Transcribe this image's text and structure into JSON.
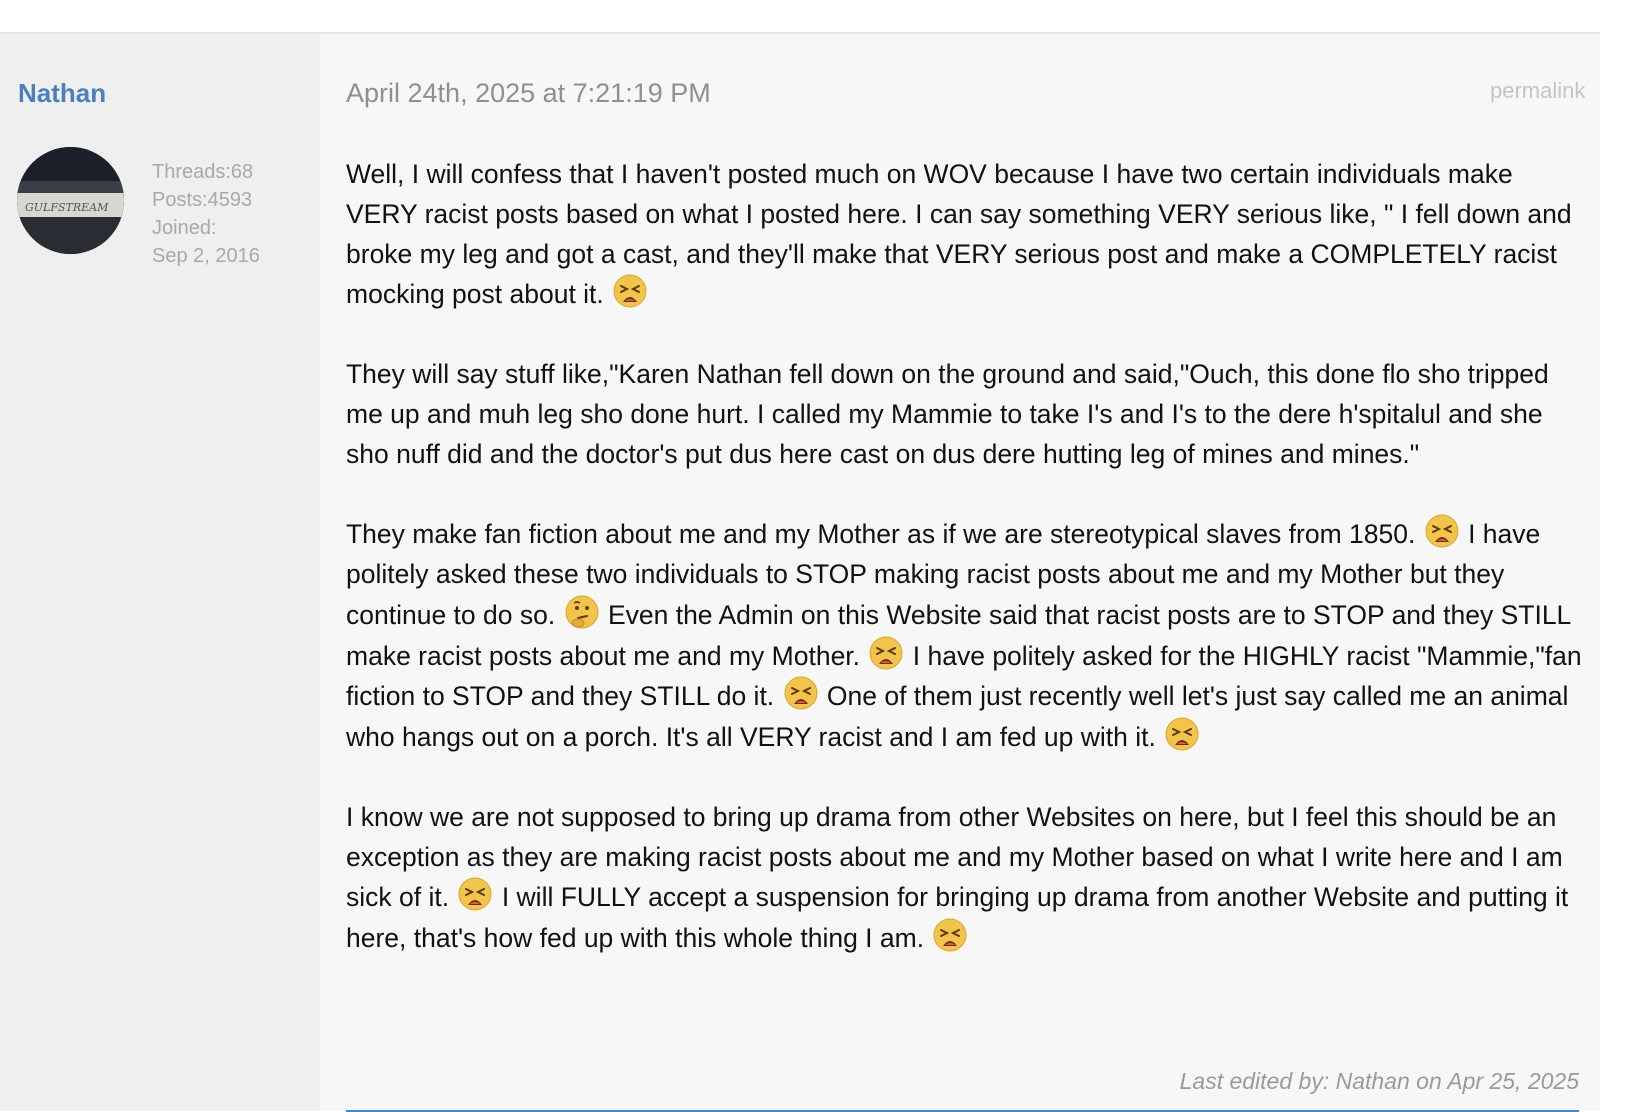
{
  "author": {
    "name": "Nathan",
    "avatar_text": "GULFSTREAM",
    "threads": "Threads:68",
    "posts": "Posts:4593",
    "joined_label": "Joined:",
    "joined_date": "Sep 2, 2016"
  },
  "post": {
    "date": "April 24th, 2025 at 7:21:19 PM",
    "permalink": "permalink",
    "paragraphs": [
      [
        {
          "t": "Well, I will confess that I haven't posted much on WOV because I have two certain individuals make VERY racist posts based on what I posted here. I can say something VERY serious like, \" I fell down and broke my leg and got a cast, and they'll make that VERY serious post and make a COMPLETELY racist mocking post about it. "
        },
        {
          "emoji": "tired-face-emoji"
        }
      ],
      [
        {
          "t": "They will say stuff like,\"Karen Nathan fell down on the ground and said,\"Ouch, this done flo sho tripped me up and muh leg sho done hurt. I called my Mammie to take I's and I's to the dere h'spitalul and she sho nuff did and the doctor's put dus here cast on dus dere hutting leg of mines and mines.\""
        }
      ],
      [
        {
          "t": "They make fan fiction about me and my Mother as if we are stereotypical slaves from 1850. "
        },
        {
          "emoji": "tired-face-emoji"
        },
        {
          "t": " I have politely asked these two individuals to STOP making racist posts about me and my Mother but they continue to do so. "
        },
        {
          "emoji": "thinking-face-emoji"
        },
        {
          "t": " Even the Admin on this Website said that racist posts are to STOP and they STILL make racist posts about me and my Mother. "
        },
        {
          "emoji": "tired-face-emoji"
        },
        {
          "t": " I have politely asked for the HIGHLY racist \"Mammie,\"fan fiction to STOP and they STILL do it. "
        },
        {
          "emoji": "tired-face-emoji"
        },
        {
          "t": " One of them just recently well let's just say called me an animal who hangs out on a porch. It's all VERY racist and I am fed up with it. "
        },
        {
          "emoji": "tired-face-emoji"
        }
      ],
      [
        {
          "t": "I know we are not supposed to bring up drama from other Websites on here, but I feel this should be an exception as they are making racist posts about me and my Mother based on what I write here and I am sick of it. "
        },
        {
          "emoji": "tired-face-emoji"
        },
        {
          "t": " I will FULLY accept a suspension for bringing up drama from another Website and putting it here, that's how fed up with this whole thing I am. "
        },
        {
          "emoji": "tired-face-emoji"
        }
      ]
    ],
    "edited": "Last edited by: Nathan on Apr 25, 2025"
  },
  "colors": {
    "username": "#4a7fc0",
    "rule": "#3f8ad0",
    "emoji_face": "#f2c44a"
  }
}
